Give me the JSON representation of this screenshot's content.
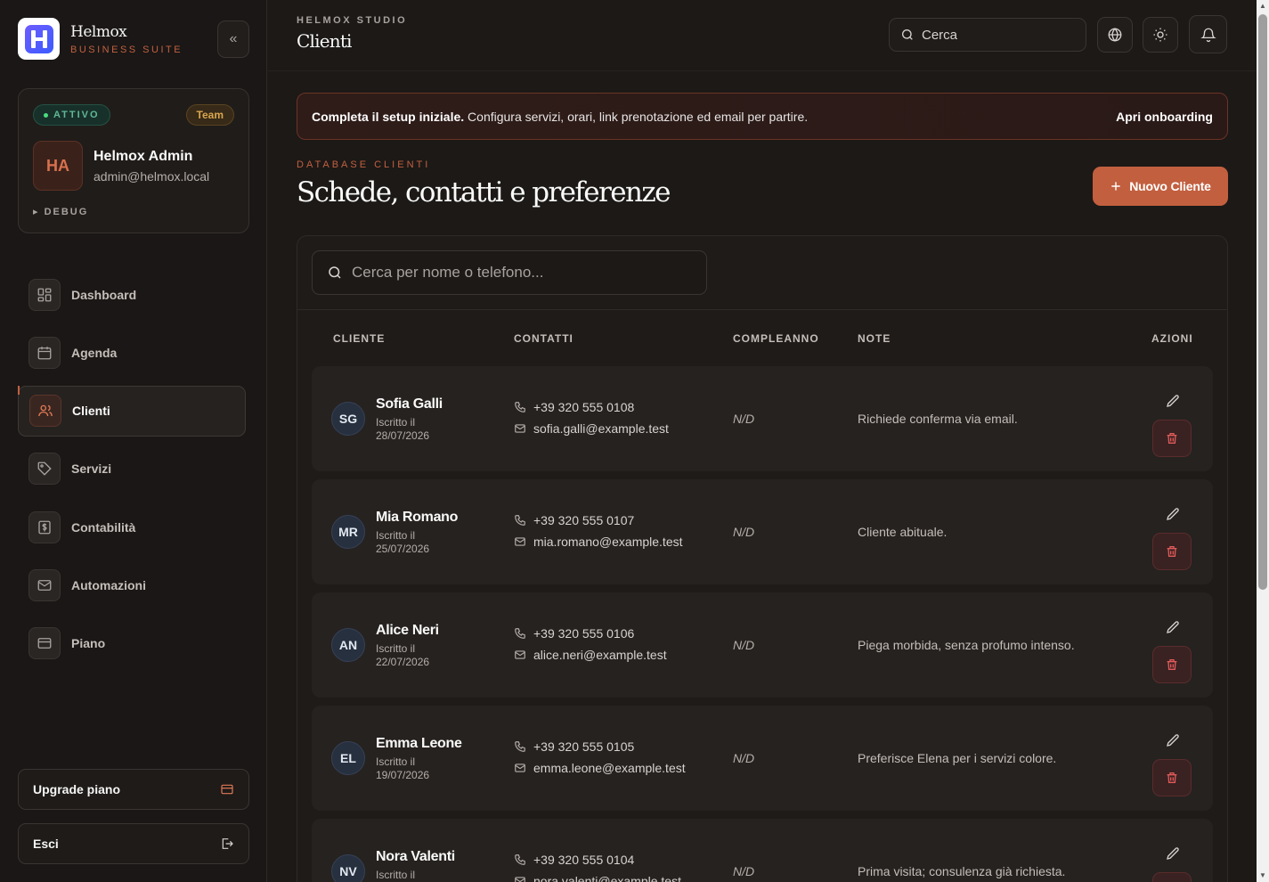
{
  "brand": {
    "name": "Helmox",
    "subtitle": "BUSINESS SUITE",
    "collapse_icon": "«"
  },
  "account": {
    "status": "ATTIVO",
    "plan_badge": "Team",
    "initials": "HA",
    "name": "Helmox Admin",
    "email": "admin@helmox.local",
    "debug_label": "▸ DEBUG"
  },
  "nav": {
    "items": [
      {
        "label": "Dashboard",
        "icon": "dashboard-icon"
      },
      {
        "label": "Agenda",
        "icon": "calendar-icon"
      },
      {
        "label": "Clienti",
        "icon": "users-icon",
        "active": true
      },
      {
        "label": "Servizi",
        "icon": "tag-icon"
      },
      {
        "label": "Contabilità",
        "icon": "receipt-icon"
      },
      {
        "label": "Automazioni",
        "icon": "mail-icon"
      },
      {
        "label": "Piano",
        "icon": "credit-card-icon"
      }
    ]
  },
  "sidebar_footer": {
    "upgrade_label": "Upgrade piano",
    "logout_label": "Esci"
  },
  "topbar": {
    "kicker": "HELMOX STUDIO",
    "title": "Clienti",
    "search_placeholder": "Cerca"
  },
  "banner": {
    "bold": "Completa il setup iniziale.",
    "text": " Configura servizi, orari, link prenotazione ed email per partire.",
    "action": "Apri onboarding"
  },
  "section": {
    "kicker": "DATABASE CLIENTI",
    "title": "Schede, contatti e preferenze",
    "new_button": "Nuovo Cliente"
  },
  "table": {
    "search_placeholder": "Cerca per nome o telefono...",
    "headers": {
      "client": "CLIENTE",
      "contacts": "CONTATTI",
      "birthday": "COMPLEANNO",
      "notes": "NOTE",
      "actions": "AZIONI"
    },
    "rows": [
      {
        "initials": "SG",
        "name": "Sofia Galli",
        "joined_label": "Iscritto il",
        "joined": "28/07/2026",
        "phone": "+39 320 555 0108",
        "email": "sofia.galli@example.test",
        "birthday": "N/D",
        "note": "Richiede conferma via email."
      },
      {
        "initials": "MR",
        "name": "Mia Romano",
        "joined_label": "Iscritto il",
        "joined": "25/07/2026",
        "phone": "+39 320 555 0107",
        "email": "mia.romano@example.test",
        "birthday": "N/D",
        "note": "Cliente abituale."
      },
      {
        "initials": "AN",
        "name": "Alice Neri",
        "joined_label": "Iscritto il",
        "joined": "22/07/2026",
        "phone": "+39 320 555 0106",
        "email": "alice.neri@example.test",
        "birthday": "N/D",
        "note": "Piega morbida, senza profumo intenso."
      },
      {
        "initials": "EL",
        "name": "Emma Leone",
        "joined_label": "Iscritto il",
        "joined": "19/07/2026",
        "phone": "+39 320 555 0105",
        "email": "emma.leone@example.test",
        "birthday": "N/D",
        "note": "Preferisce Elena per i servizi colore."
      },
      {
        "initials": "NV",
        "name": "Nora Valenti",
        "joined_label": "Iscritto il",
        "joined": "",
        "phone": "+39 320 555 0104",
        "email": "nora.valenti@example.test",
        "birthday": "N/D",
        "note": "Prima visita; consulenza già richiesta."
      }
    ]
  }
}
